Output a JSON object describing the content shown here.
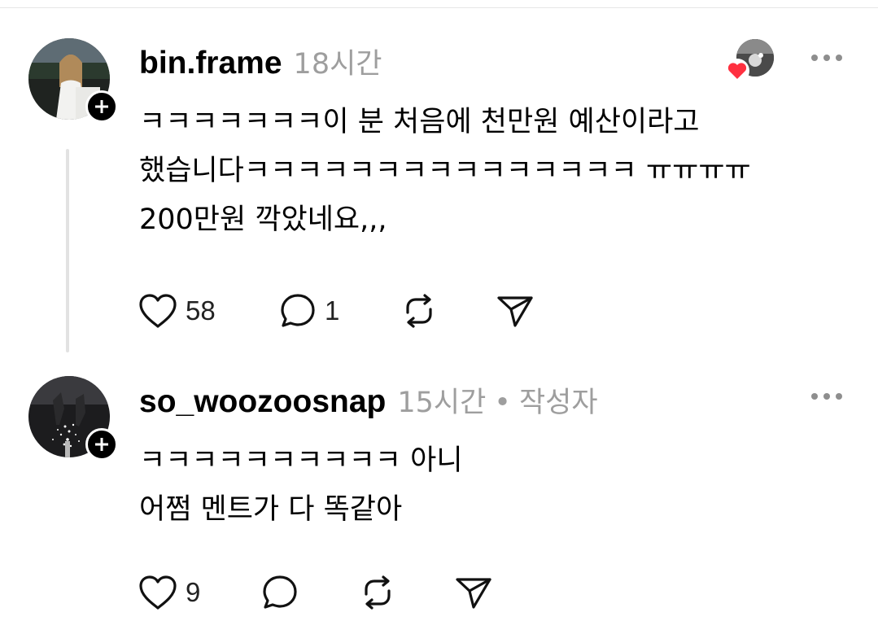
{
  "thread": {
    "comment1": {
      "username": "bin.frame",
      "time": "18시간",
      "avatar_icon": "profile-photo",
      "follow_icon": "plus-icon",
      "liked_by_icon": "heart-icon",
      "lines": [
        "ㅋㅋㅋㅋㅋㅋㅋ이 분 처음에 천만원 예산이라고",
        "했습니다ㅋㅋㅋㅋㅋㅋㅋㅋㅋㅋㅋㅋㅋㅋㅋ ㅠㅠㅠㅠ",
        "200만원 깍았네요,,,"
      ],
      "likes": "58",
      "replies": "1"
    },
    "comment2": {
      "username": "so_woozoosnap",
      "time": "15시간",
      "separator": "•",
      "author_tag": "작성자",
      "avatar_icon": "profile-photo",
      "follow_icon": "plus-icon",
      "lines": [
        "ㅋㅋㅋㅋㅋㅋㅋㅋㅋㅋ 아니",
        "어쩜 멘트가 다 똑같아"
      ],
      "likes": "9",
      "replies": ""
    }
  },
  "colors": {
    "text": "#000000",
    "muted": "#9e9e9e",
    "heart": "#ff3040",
    "thread_line": "#e2e2e2"
  }
}
